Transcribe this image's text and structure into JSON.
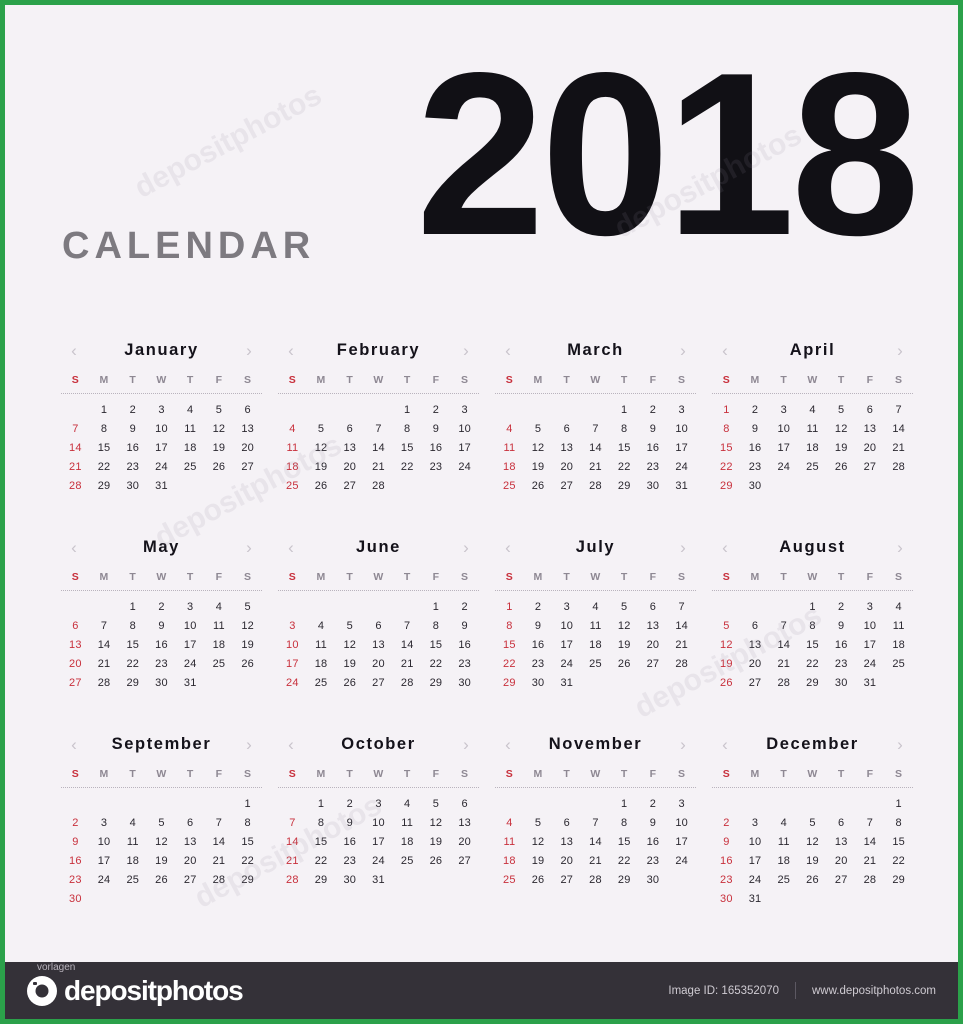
{
  "header": {
    "title_word": "CALENDAR",
    "year": "2018"
  },
  "colors": {
    "background": "#f5f2f6",
    "border": "#2ba14a",
    "sunday": "#c8303c",
    "day_text": "#2b2830",
    "month_title": "#14121a",
    "weekday": "#8e8893",
    "arrow": "#c9c4cc",
    "footer_bg": "#343138"
  },
  "nav": {
    "prev": "‹",
    "next": "›"
  },
  "weekdays": [
    "S",
    "M",
    "T",
    "W",
    "T",
    "F",
    "S"
  ],
  "months": [
    {
      "name": "January",
      "lead_blanks": 1,
      "days": 31,
      "weeks": [
        [
          "",
          "1",
          "2",
          "3",
          "4",
          "5",
          "6"
        ],
        [
          "7",
          "8",
          "9",
          "10",
          "11",
          "12",
          "13"
        ],
        [
          "14",
          "15",
          "16",
          "17",
          "18",
          "19",
          "20"
        ],
        [
          "21",
          "22",
          "23",
          "24",
          "25",
          "26",
          "27"
        ],
        [
          "28",
          "29",
          "30",
          "31",
          "",
          "",
          ""
        ]
      ]
    },
    {
      "name": "February",
      "lead_blanks": 4,
      "days": 28,
      "weeks": [
        [
          "",
          "",
          "",
          "",
          "1",
          "2",
          "3"
        ],
        [
          "4",
          "5",
          "6",
          "7",
          "8",
          "9",
          "10"
        ],
        [
          "11",
          "12",
          "13",
          "14",
          "15",
          "16",
          "17"
        ],
        [
          "18",
          "19",
          "20",
          "21",
          "22",
          "23",
          "24"
        ],
        [
          "25",
          "26",
          "27",
          "28",
          "",
          "",
          ""
        ]
      ]
    },
    {
      "name": "March",
      "lead_blanks": 4,
      "days": 31,
      "weeks": [
        [
          "",
          "",
          "",
          "",
          "1",
          "2",
          "3"
        ],
        [
          "4",
          "5",
          "6",
          "7",
          "8",
          "9",
          "10"
        ],
        [
          "11",
          "12",
          "13",
          "14",
          "15",
          "16",
          "17"
        ],
        [
          "18",
          "19",
          "20",
          "21",
          "22",
          "23",
          "24"
        ],
        [
          "25",
          "26",
          "27",
          "28",
          "29",
          "30",
          "31"
        ]
      ]
    },
    {
      "name": "April",
      "lead_blanks": 0,
      "days": 30,
      "weeks": [
        [
          "1",
          "2",
          "3",
          "4",
          "5",
          "6",
          "7"
        ],
        [
          "8",
          "9",
          "10",
          "11",
          "12",
          "13",
          "14"
        ],
        [
          "15",
          "16",
          "17",
          "18",
          "19",
          "20",
          "21"
        ],
        [
          "22",
          "23",
          "24",
          "25",
          "26",
          "27",
          "28"
        ],
        [
          "29",
          "30",
          "",
          "",
          "",
          "",
          ""
        ]
      ]
    },
    {
      "name": "May",
      "lead_blanks": 2,
      "days": 31,
      "weeks": [
        [
          "",
          "",
          "1",
          "2",
          "3",
          "4",
          "5"
        ],
        [
          "6",
          "7",
          "8",
          "9",
          "10",
          "11",
          "12"
        ],
        [
          "13",
          "14",
          "15",
          "16",
          "17",
          "18",
          "19"
        ],
        [
          "20",
          "21",
          "22",
          "23",
          "24",
          "25",
          "26"
        ],
        [
          "27",
          "28",
          "29",
          "30",
          "31",
          "",
          ""
        ]
      ]
    },
    {
      "name": "June",
      "lead_blanks": 5,
      "days": 30,
      "weeks": [
        [
          "",
          "",
          "",
          "",
          "",
          "1",
          "2"
        ],
        [
          "3",
          "4",
          "5",
          "6",
          "7",
          "8",
          "9"
        ],
        [
          "10",
          "11",
          "12",
          "13",
          "14",
          "15",
          "16"
        ],
        [
          "17",
          "18",
          "19",
          "20",
          "21",
          "22",
          "23"
        ],
        [
          "24",
          "25",
          "26",
          "27",
          "28",
          "29",
          "30"
        ]
      ]
    },
    {
      "name": "July",
      "lead_blanks": 0,
      "days": 31,
      "weeks": [
        [
          "1",
          "2",
          "3",
          "4",
          "5",
          "6",
          "7"
        ],
        [
          "8",
          "9",
          "10",
          "11",
          "12",
          "13",
          "14"
        ],
        [
          "15",
          "16",
          "17",
          "18",
          "19",
          "20",
          "21"
        ],
        [
          "22",
          "23",
          "24",
          "25",
          "26",
          "27",
          "28"
        ],
        [
          "29",
          "30",
          "31",
          "",
          "",
          "",
          ""
        ]
      ]
    },
    {
      "name": "August",
      "lead_blanks": 3,
      "days": 31,
      "weeks": [
        [
          "",
          "",
          "",
          "1",
          "2",
          "3",
          "4"
        ],
        [
          "5",
          "6",
          "7",
          "8",
          "9",
          "10",
          "11"
        ],
        [
          "12",
          "13",
          "14",
          "15",
          "16",
          "17",
          "18"
        ],
        [
          "19",
          "20",
          "21",
          "22",
          "23",
          "24",
          "25"
        ],
        [
          "26",
          "27",
          "28",
          "29",
          "30",
          "31",
          ""
        ]
      ]
    },
    {
      "name": "September",
      "lead_blanks": 6,
      "days": 30,
      "weeks": [
        [
          "",
          "",
          "",
          "",
          "",
          "",
          "1"
        ],
        [
          "2",
          "3",
          "4",
          "5",
          "6",
          "7",
          "8"
        ],
        [
          "9",
          "10",
          "11",
          "12",
          "13",
          "14",
          "15"
        ],
        [
          "16",
          "17",
          "18",
          "19",
          "20",
          "21",
          "22"
        ],
        [
          "23",
          "24",
          "25",
          "26",
          "27",
          "28",
          "29"
        ],
        [
          "30",
          "",
          "",
          "",
          "",
          "",
          ""
        ]
      ]
    },
    {
      "name": "October",
      "lead_blanks": 1,
      "days": 31,
      "weeks": [
        [
          "",
          "1",
          "2",
          "3",
          "4",
          "5",
          "6"
        ],
        [
          "7",
          "8",
          "9",
          "10",
          "11",
          "12",
          "13"
        ],
        [
          "14",
          "15",
          "16",
          "17",
          "18",
          "19",
          "20"
        ],
        [
          "21",
          "22",
          "23",
          "24",
          "25",
          "26",
          "27"
        ],
        [
          "28",
          "29",
          "30",
          "31",
          "",
          "",
          ""
        ]
      ]
    },
    {
      "name": "November",
      "lead_blanks": 4,
      "days": 30,
      "weeks": [
        [
          "",
          "",
          "",
          "",
          "1",
          "2",
          "3"
        ],
        [
          "4",
          "5",
          "6",
          "7",
          "8",
          "9",
          "10"
        ],
        [
          "11",
          "12",
          "13",
          "14",
          "15",
          "16",
          "17"
        ],
        [
          "18",
          "19",
          "20",
          "21",
          "22",
          "23",
          "24"
        ],
        [
          "25",
          "26",
          "27",
          "28",
          "29",
          "30",
          ""
        ]
      ]
    },
    {
      "name": "December",
      "lead_blanks": 6,
      "days": 31,
      "weeks": [
        [
          "",
          "",
          "",
          "",
          "",
          "",
          "1"
        ],
        [
          "2",
          "3",
          "4",
          "5",
          "6",
          "7",
          "8"
        ],
        [
          "9",
          "10",
          "11",
          "12",
          "13",
          "14",
          "15"
        ],
        [
          "16",
          "17",
          "18",
          "19",
          "20",
          "21",
          "22"
        ],
        [
          "23",
          "24",
          "25",
          "26",
          "27",
          "28",
          "29"
        ],
        [
          "30",
          "31",
          "",
          "",
          "",
          "",
          ""
        ]
      ]
    }
  ],
  "watermark": {
    "overlay_text": "vorlagen",
    "diagonal_text": "depositphotos"
  },
  "footer": {
    "brand": "depositphotos",
    "image_id": "Image ID: 165352070",
    "website": "www.depositphotos.com"
  }
}
